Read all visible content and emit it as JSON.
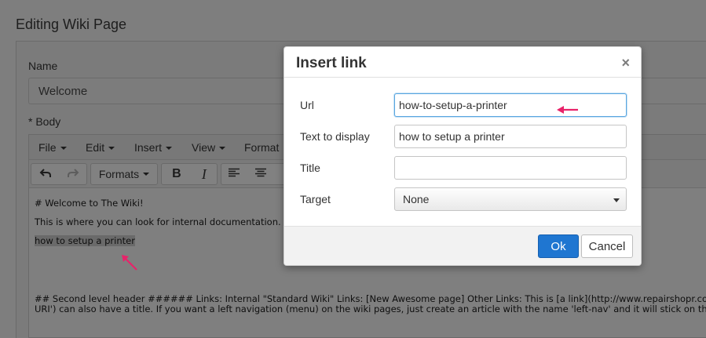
{
  "page": {
    "title": "Editing Wiki Page",
    "name_label": "Name",
    "name_value": "Welcome",
    "body_label": "* Body"
  },
  "editor": {
    "menu": [
      {
        "label": "File"
      },
      {
        "label": "Edit"
      },
      {
        "label": "Insert"
      },
      {
        "label": "View"
      },
      {
        "label": "Format"
      }
    ],
    "toolbar": {
      "formats_label": "Formats",
      "bold_label": "B",
      "italic_label": "I"
    },
    "content": {
      "line1": "# Welcome to The Wiki!",
      "line2": "This is where you can look for internal documentation.",
      "line3": "how to setup a printer",
      "line4": "## Second level header ###### Links: Internal \"Standard Wiki\" Links: [New Awesome page] Other Links: This is [a link](http://www.repairshopr.com)",
      "line5": "URI') can also have a title. If you want a left navigation (menu) on the wiki pages, just create an article with the name 'left-nav' and it will stick on the lef"
    }
  },
  "dialog": {
    "title": "Insert link",
    "close_glyph": "×",
    "url_label": "Url",
    "url_value": "how-to-setup-a-printer",
    "text_label": "Text to display",
    "text_value": "how to setup a printer",
    "title_label": "Title",
    "title_value": "",
    "target_label": "Target",
    "target_value": "None",
    "ok_label": "Ok",
    "cancel_label": "Cancel"
  },
  "colors": {
    "accent": "#1f76d1",
    "annotation_arrow": "#e8236a",
    "focus_border": "#5aa6e0"
  },
  "icons": [
    "undo-icon",
    "redo-icon",
    "align-left-icon",
    "align-center-icon",
    "close-icon",
    "chevron-down-icon"
  ]
}
